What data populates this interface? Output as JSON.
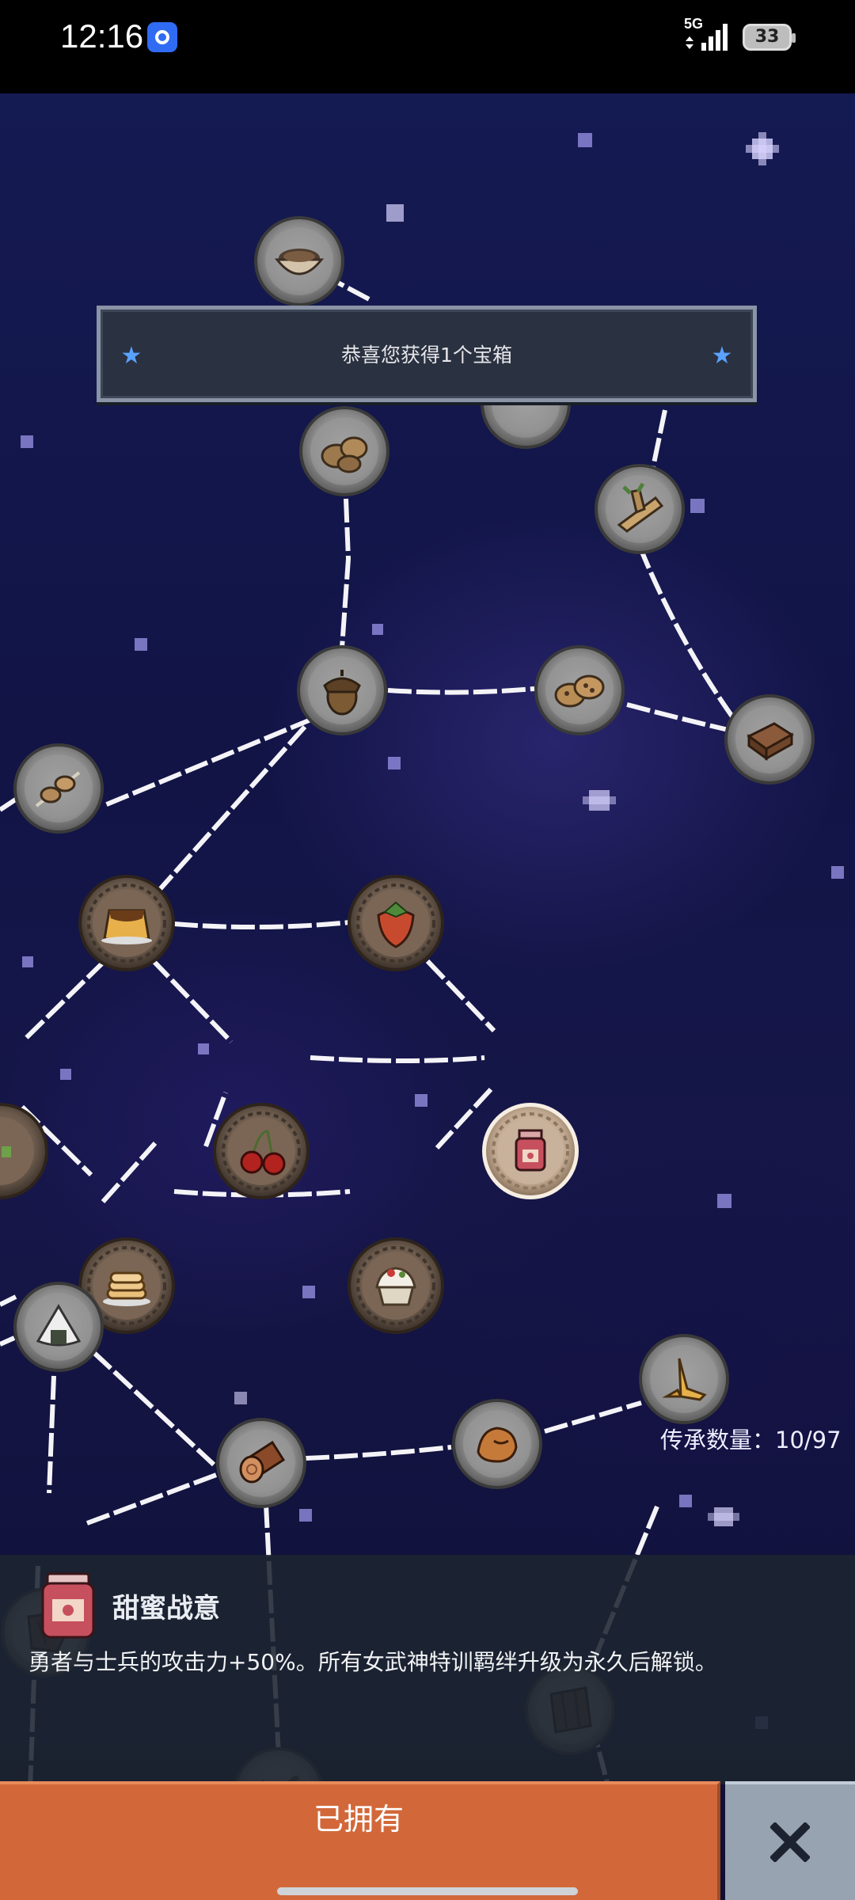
{
  "status_bar": {
    "time": "12:16",
    "network": "5G",
    "battery": "33"
  },
  "notice": {
    "text": "恭喜您获得1个宝箱"
  },
  "counter": {
    "label": "传承数量：10/97"
  },
  "info": {
    "title": "甜蜜战意",
    "description": "勇者与士兵的攻击力+50%。所有女武神特训羁绊升级为永久后解锁。"
  },
  "buttons": {
    "owned_label": "已拥有"
  },
  "nodes": [
    {
      "id": "bowl",
      "icon": "bowl-icon",
      "state": "locked"
    },
    {
      "id": "unknown-top",
      "icon": "bowl-icon",
      "state": "locked"
    },
    {
      "id": "potato",
      "icon": "potato-icon",
      "state": "locked"
    },
    {
      "id": "ginger",
      "icon": "ginger-root-icon",
      "state": "locked"
    },
    {
      "id": "acorn",
      "icon": "acorn-icon",
      "state": "locked"
    },
    {
      "id": "cookies",
      "icon": "cookies-icon",
      "state": "locked"
    },
    {
      "id": "chocolate",
      "icon": "chocolate-icon",
      "state": "locked"
    },
    {
      "id": "skewer",
      "icon": "skewer-icon",
      "state": "locked"
    },
    {
      "id": "pudding",
      "icon": "pudding-icon",
      "state": "unlocked"
    },
    {
      "id": "strawberry",
      "icon": "strawberry-icon",
      "state": "unlocked"
    },
    {
      "id": "left-partial",
      "icon": "food-icon",
      "state": "unlocked"
    },
    {
      "id": "cherry",
      "icon": "cherry-icon",
      "state": "unlocked"
    },
    {
      "id": "jam",
      "icon": "jam-jar-icon",
      "state": "selected"
    },
    {
      "id": "pancakes",
      "icon": "pancakes-icon",
      "state": "unlocked"
    },
    {
      "id": "cake",
      "icon": "cream-cake-icon",
      "state": "unlocked"
    },
    {
      "id": "onigiri",
      "icon": "onigiri-icon",
      "state": "locked"
    },
    {
      "id": "carrot",
      "icon": "carrot-icon",
      "state": "locked"
    },
    {
      "id": "log",
      "icon": "log-icon",
      "state": "locked"
    },
    {
      "id": "chestnut",
      "icon": "chestnut-icon",
      "state": "locked"
    },
    {
      "id": "bark",
      "icon": "bark-icon",
      "state": "locked"
    },
    {
      "id": "plank",
      "icon": "plank-icon",
      "state": "locked"
    },
    {
      "id": "twig",
      "icon": "twig-icon",
      "state": "locked"
    },
    {
      "id": "stick",
      "icon": "stick-icon",
      "state": "locked"
    },
    {
      "id": "box",
      "icon": "wood-box-icon",
      "state": "locked"
    },
    {
      "id": "bottom-left",
      "icon": "stone-icon",
      "state": "locked"
    }
  ]
}
